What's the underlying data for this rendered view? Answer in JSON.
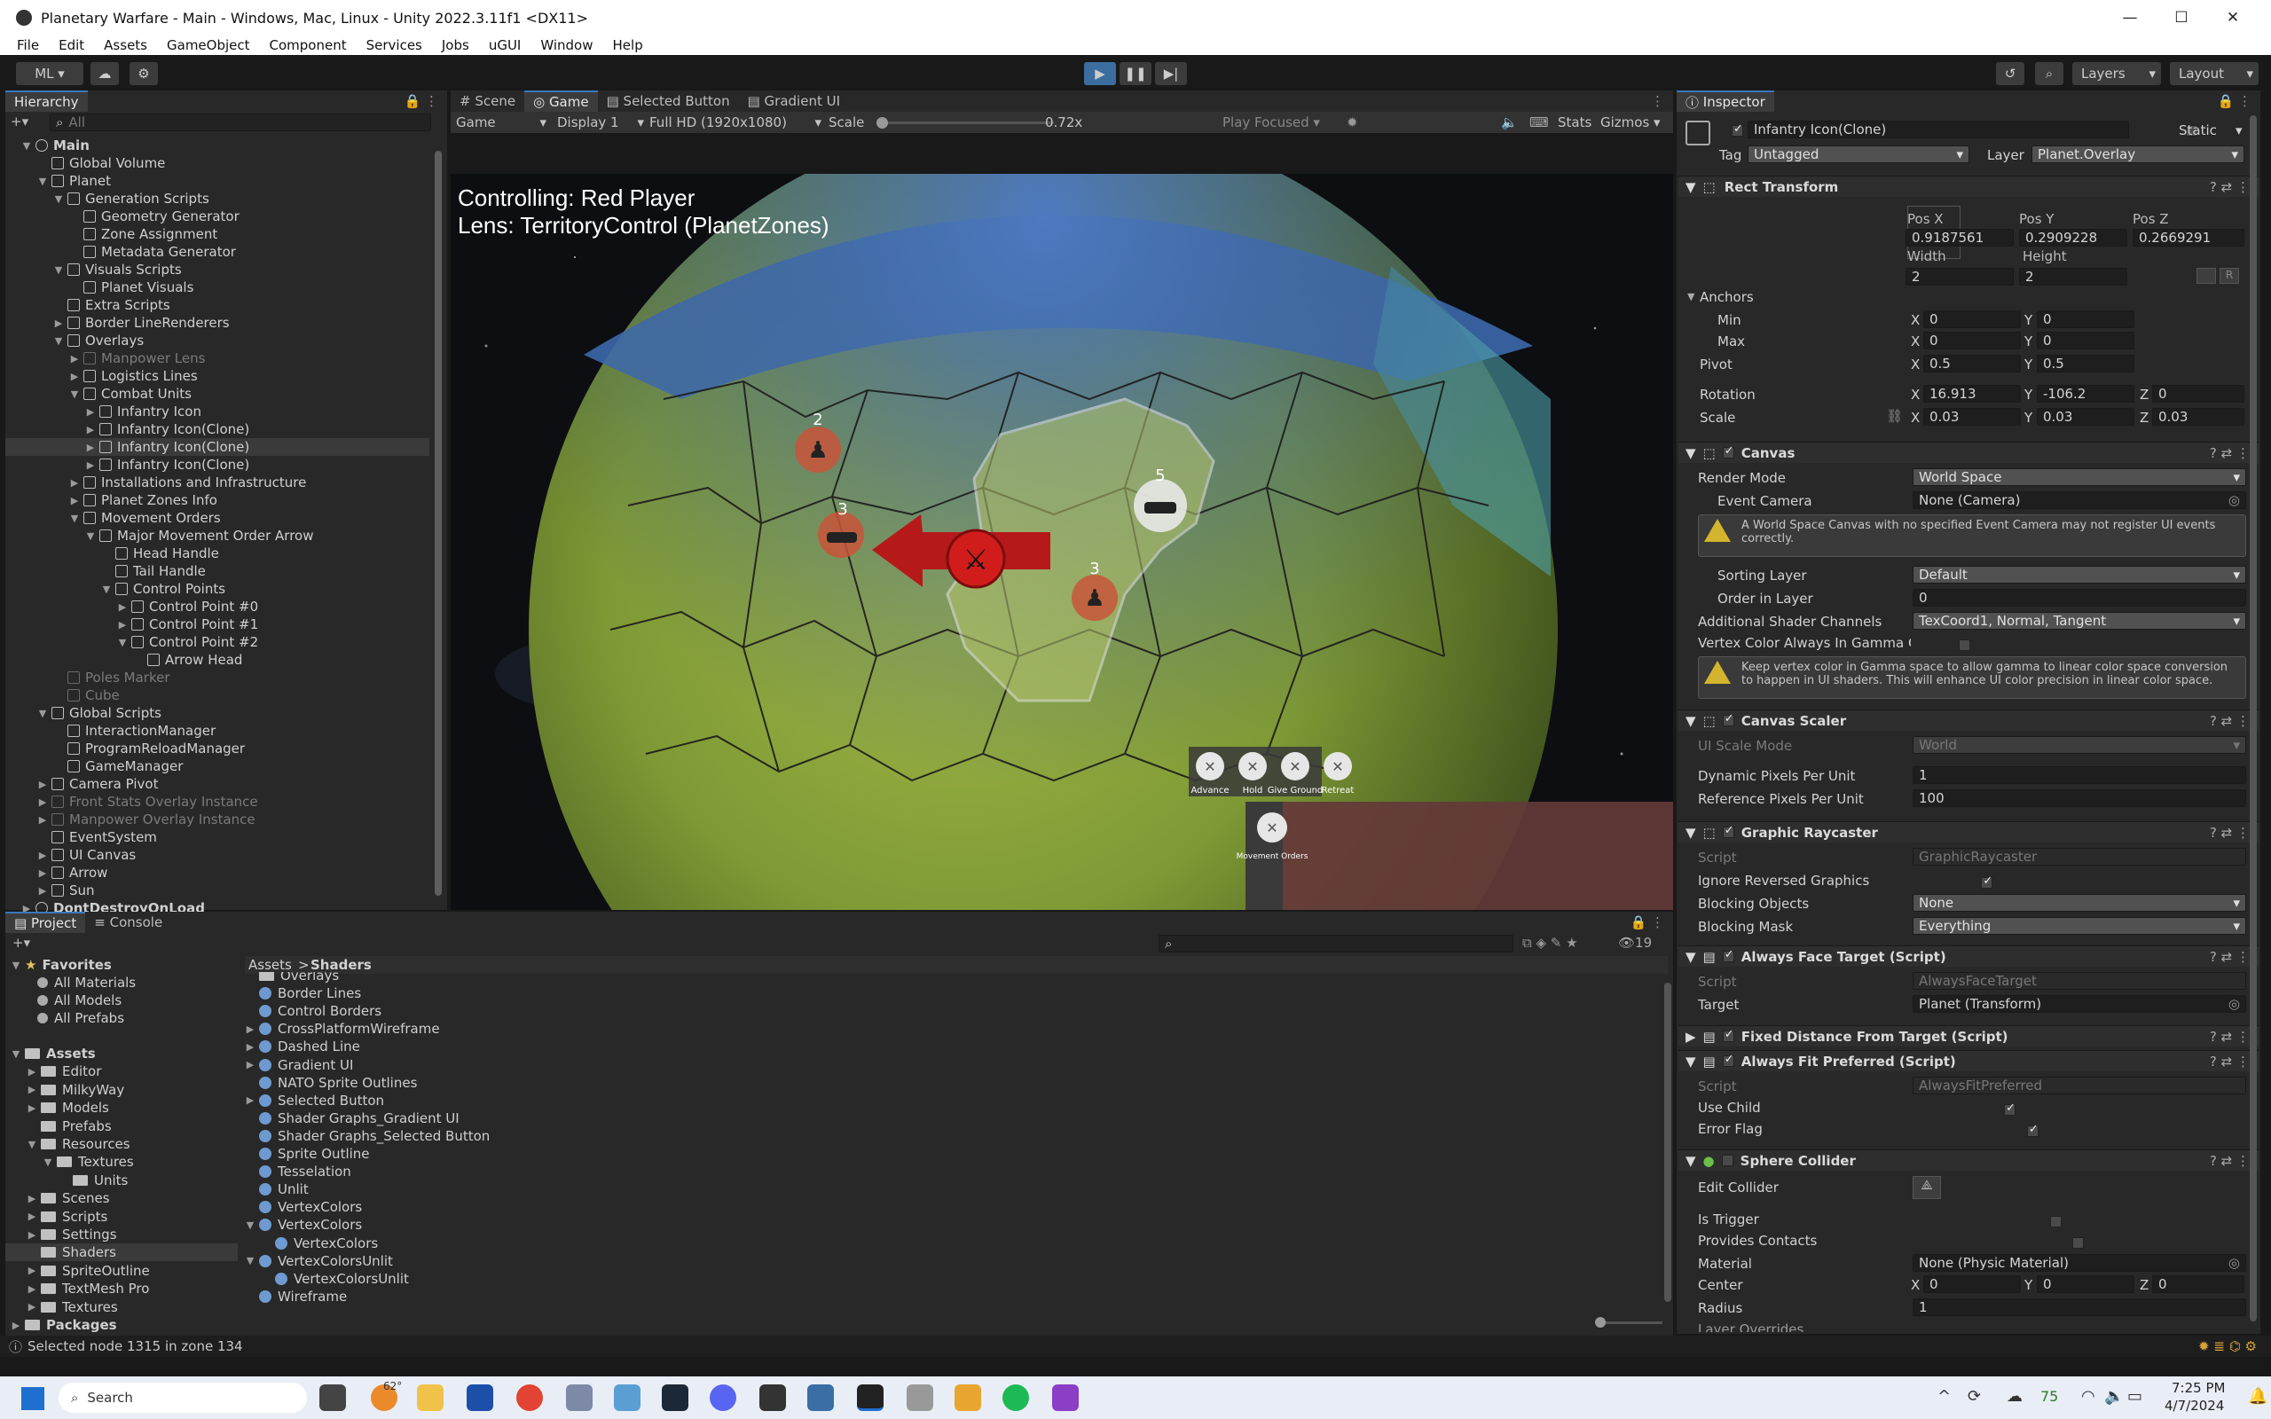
{
  "window": {
    "title": "Planetary Warfare - Main - Windows, Mac, Linux - Unity 2022.3.11f1 <DX11>",
    "minimize": "—",
    "maximize": "☐",
    "close": "✕"
  },
  "menu": [
    "File",
    "Edit",
    "Assets",
    "GameObject",
    "Component",
    "Services",
    "Jobs",
    "uGUI",
    "Window",
    "Help"
  ],
  "toolbar": {
    "account": "ML ▾",
    "layers": "Layers",
    "layout": "Layout"
  },
  "hierarchy": {
    "tab": "Hierarchy",
    "search_placeholder": "All",
    "rows": [
      {
        "label": "Main",
        "indent": 0,
        "arrow": "▼",
        "style": "scene"
      },
      {
        "label": "Global Volume",
        "indent": 1,
        "arrow": "",
        "style": ""
      },
      {
        "label": "Planet",
        "indent": 1,
        "arrow": "▼",
        "style": ""
      },
      {
        "label": "Generation Scripts",
        "indent": 2,
        "arrow": "▼",
        "style": ""
      },
      {
        "label": "Geometry Generator",
        "indent": 3,
        "arrow": "",
        "style": ""
      },
      {
        "label": "Zone Assignment",
        "indent": 3,
        "arrow": "",
        "style": ""
      },
      {
        "label": "Metadata Generator",
        "indent": 3,
        "arrow": "",
        "style": ""
      },
      {
        "label": "Visuals Scripts",
        "indent": 2,
        "arrow": "▼",
        "style": ""
      },
      {
        "label": "Planet Visuals",
        "indent": 3,
        "arrow": "",
        "style": ""
      },
      {
        "label": "Extra Scripts",
        "indent": 2,
        "arrow": "",
        "style": ""
      },
      {
        "label": "Border LineRenderers",
        "indent": 2,
        "arrow": "▶",
        "style": ""
      },
      {
        "label": "Overlays",
        "indent": 2,
        "arrow": "▼",
        "style": ""
      },
      {
        "label": "Manpower Lens",
        "indent": 3,
        "arrow": "▶",
        "style": "dim"
      },
      {
        "label": "Logistics Lines",
        "indent": 3,
        "arrow": "▶",
        "style": ""
      },
      {
        "label": "Combat Units",
        "indent": 3,
        "arrow": "▼",
        "style": ""
      },
      {
        "label": "Infantry Icon",
        "indent": 4,
        "arrow": "▶",
        "style": ""
      },
      {
        "label": "Infantry Icon(Clone)",
        "indent": 4,
        "arrow": "▶",
        "style": ""
      },
      {
        "label": "Infantry Icon(Clone)",
        "indent": 4,
        "arrow": "▶",
        "style": "hl"
      },
      {
        "label": "Infantry Icon(Clone)",
        "indent": 4,
        "arrow": "▶",
        "style": ""
      },
      {
        "label": "Installations and Infrastructure",
        "indent": 3,
        "arrow": "▶",
        "style": ""
      },
      {
        "label": "Planet Zones Info",
        "indent": 3,
        "arrow": "▶",
        "style": ""
      },
      {
        "label": "Movement Orders",
        "indent": 3,
        "arrow": "▼",
        "style": ""
      },
      {
        "label": "Major Movement Order Arrow",
        "indent": 4,
        "arrow": "▼",
        "style": ""
      },
      {
        "label": "Head Handle",
        "indent": 5,
        "arrow": "",
        "style": ""
      },
      {
        "label": "Tail Handle",
        "indent": 5,
        "arrow": "",
        "style": ""
      },
      {
        "label": "Control Points",
        "indent": 5,
        "arrow": "▼",
        "style": ""
      },
      {
        "label": "Control Point #0",
        "indent": 6,
        "arrow": "▶",
        "style": ""
      },
      {
        "label": "Control Point #1",
        "indent": 6,
        "arrow": "▶",
        "style": ""
      },
      {
        "label": "Control Point #2",
        "indent": 6,
        "arrow": "▼",
        "style": ""
      },
      {
        "label": "Arrow Head",
        "indent": 7,
        "arrow": "",
        "style": ""
      },
      {
        "label": "Poles Marker",
        "indent": 2,
        "arrow": "",
        "style": "dim"
      },
      {
        "label": "Cube",
        "indent": 2,
        "arrow": "",
        "style": "dim"
      },
      {
        "label": "Global Scripts",
        "indent": 1,
        "arrow": "▼",
        "style": ""
      },
      {
        "label": "InteractionManager",
        "indent": 2,
        "arrow": "",
        "style": ""
      },
      {
        "label": "ProgramReloadManager",
        "indent": 2,
        "arrow": "",
        "style": ""
      },
      {
        "label": "GameManager",
        "indent": 2,
        "arrow": "",
        "style": ""
      },
      {
        "label": "Camera Pivot",
        "indent": 1,
        "arrow": "▶",
        "style": ""
      },
      {
        "label": "Front Stats Overlay Instance",
        "indent": 1,
        "arrow": "▶",
        "style": "dim"
      },
      {
        "label": "Manpower Overlay Instance",
        "indent": 1,
        "arrow": "▶",
        "style": "dim"
      },
      {
        "label": "EventSystem",
        "indent": 1,
        "arrow": "",
        "style": ""
      },
      {
        "label": "UI Canvas",
        "indent": 1,
        "arrow": "▶",
        "style": ""
      },
      {
        "label": "Arrow",
        "indent": 1,
        "arrow": "▶",
        "style": ""
      },
      {
        "label": "Sun",
        "indent": 1,
        "arrow": "▶",
        "style": ""
      },
      {
        "label": "DontDestroyOnLoad",
        "indent": 0,
        "arrow": "▶",
        "style": "scene"
      }
    ]
  },
  "scene_tabs": [
    {
      "label": "Scene"
    },
    {
      "label": "Game"
    },
    {
      "label": "Selected Button"
    },
    {
      "label": "Gradient UI"
    }
  ],
  "game_bar": {
    "mode": "Game",
    "display": "Display 1",
    "resolution": "Full HD (1920x1080)",
    "scale_label": "Scale",
    "scale_value": "0.72x",
    "play_focused": "Play Focused",
    "stats": "Stats",
    "gizmos": "Gizmos"
  },
  "game_view": {
    "controlling": "Controlling: Red Player",
    "lens": "Lens: TerritoryControl (PlanetZones)",
    "unit_counts": [
      "2",
      "3",
      "5",
      "3"
    ],
    "orders": [
      {
        "label": "Advance"
      },
      {
        "label": "Hold"
      },
      {
        "label": "Give Ground"
      },
      {
        "label": "Retreat"
      }
    ],
    "movement_orders": "Movement Orders"
  },
  "inspector": {
    "tab": "Inspector",
    "object_name": "Infantry Icon(Clone)",
    "static_label": "Static",
    "tag_label": "Tag",
    "tag_value": "Untagged",
    "layer_label": "Layer",
    "layer_value": "Planet.Overlay",
    "rect_transform": {
      "title": "Rect Transform",
      "posx_label": "Pos X",
      "posy_label": "Pos Y",
      "posz_label": "Pos Z",
      "posx": "0.9187561",
      "posy": "0.2909228",
      "posz": "0.2669291",
      "width_label": "Width",
      "height_label": "Height",
      "width": "2",
      "height": "2",
      "anchors": "Anchors",
      "min": "Min",
      "max": "Max",
      "min_x": "0",
      "min_y": "0",
      "max_x": "0",
      "max_y": "0",
      "pivot": "Pivot",
      "pivot_x": "0.5",
      "pivot_y": "0.5",
      "rotation": "Rotation",
      "rot_x": "16.913",
      "rot_y": "-106.2",
      "rot_z": "0",
      "scale": "Scale",
      "scale_x": "0.03",
      "scale_y": "0.03",
      "scale_z": "0.03",
      "raw_btn": "R"
    },
    "canvas": {
      "title": "Canvas",
      "render_mode_label": "Render Mode",
      "render_mode": "World Space",
      "event_camera_label": "Event Camera",
      "event_camera": "None (Camera)",
      "warning1": "A World Space Canvas with no specified Event Camera may not register UI events correctly.",
      "sorting_layer_label": "Sorting Layer",
      "sorting_layer": "Default",
      "order_label": "Order in Layer",
      "order": "0",
      "shader_channels_label": "Additional Shader Channels",
      "shader_channels": "TexCoord1, Normal, Tangent",
      "vertex_color_label": "Vertex Color Always In Gamma C",
      "warning2": "Keep vertex color in Gamma space to allow gamma to linear color space conversion to happen in UI shaders. This will enhance UI color precision in linear color space."
    },
    "canvas_scaler": {
      "title": "Canvas Scaler",
      "ui_scale_label": "UI Scale Mode",
      "ui_scale": "World",
      "dynamic_label": "Dynamic Pixels Per Unit",
      "dynamic": "1",
      "reference_label": "Reference Pixels Per Unit",
      "reference": "100"
    },
    "graphic_raycaster": {
      "title": "Graphic Raycaster",
      "script_label": "Script",
      "script": "GraphicRaycaster",
      "ignore_label": "Ignore Reversed Graphics",
      "blocking_objects_label": "Blocking Objects",
      "blocking_objects": "None",
      "blocking_mask_label": "Blocking Mask",
      "blocking_mask": "Everything"
    },
    "always_face": {
      "title": "Always Face Target (Script)",
      "script_label": "Script",
      "script": "AlwaysFaceTarget",
      "target_label": "Target",
      "target": "Planet (Transform)"
    },
    "fixed_distance": {
      "title": "Fixed Distance From Target (Script)"
    },
    "always_fit": {
      "title": "Always Fit Preferred (Script)",
      "script_label": "Script",
      "script": "AlwaysFitPreferred",
      "use_child_label": "Use Child",
      "error_flag_label": "Error Flag"
    },
    "sphere_collider": {
      "title": "Sphere Collider",
      "edit_label": "Edit Collider",
      "trigger_label": "Is Trigger",
      "contacts_label": "Provides Contacts",
      "material_label": "Material",
      "material": "None (Physic Material)",
      "center_label": "Center",
      "center_x": "0",
      "center_y": "0",
      "center_z": "0",
      "radius_label": "Radius",
      "radius": "1",
      "layer_overrides": "Layer Overrides"
    }
  },
  "project": {
    "tabs": [
      {
        "label": "Project"
      },
      {
        "label": "Console"
      }
    ],
    "breadcrumb": [
      "Assets",
      "Shaders"
    ],
    "hidden_count": "19",
    "favorites": "Favorites",
    "fav_items": [
      "All Materials",
      "All Models",
      "All Prefabs"
    ],
    "tree": [
      {
        "label": "Assets",
        "indent": 0,
        "arrow": "▼"
      },
      {
        "label": "Editor",
        "indent": 1,
        "arrow": "▶"
      },
      {
        "label": "MilkyWay",
        "indent": 1,
        "arrow": "▶"
      },
      {
        "label": "Models",
        "indent": 1,
        "arrow": "▶"
      },
      {
        "label": "Prefabs",
        "indent": 1,
        "arrow": ""
      },
      {
        "label": "Resources",
        "indent": 1,
        "arrow": "▼"
      },
      {
        "label": "Textures",
        "indent": 2,
        "arrow": "▼"
      },
      {
        "label": "Units",
        "indent": 3,
        "arrow": ""
      },
      {
        "label": "Scenes",
        "indent": 1,
        "arrow": "▶"
      },
      {
        "label": "Scripts",
        "indent": 1,
        "arrow": "▶"
      },
      {
        "label": "Settings",
        "indent": 1,
        "arrow": "▶"
      },
      {
        "label": "Shaders",
        "indent": 1,
        "arrow": ""
      },
      {
        "label": "SpriteOutline",
        "indent": 1,
        "arrow": "▶"
      },
      {
        "label": "TextMesh Pro",
        "indent": 1,
        "arrow": "▶"
      },
      {
        "label": "Textures",
        "indent": 1,
        "arrow": "▶"
      },
      {
        "label": "Packages",
        "indent": 0,
        "arrow": "▶"
      }
    ],
    "files": [
      {
        "label": "Overlays",
        "indent": 0,
        "arrow": "",
        "kind": "folder"
      },
      {
        "label": "Border Lines",
        "indent": 0,
        "arrow": "",
        "kind": "shader"
      },
      {
        "label": "Control Borders",
        "indent": 0,
        "arrow": "",
        "kind": "shader"
      },
      {
        "label": "CrossPlatformWireframe",
        "indent": 0,
        "arrow": "▶",
        "kind": "shader"
      },
      {
        "label": "Dashed Line",
        "indent": 0,
        "arrow": "▶",
        "kind": "shader"
      },
      {
        "label": "Gradient UI",
        "indent": 0,
        "arrow": "▶",
        "kind": "shader"
      },
      {
        "label": "NATO Sprite Outlines",
        "indent": 0,
        "arrow": "",
        "kind": "shader"
      },
      {
        "label": "Selected Button",
        "indent": 0,
        "arrow": "▶",
        "kind": "shader"
      },
      {
        "label": "Shader Graphs_Gradient UI",
        "indent": 0,
        "arrow": "",
        "kind": "shader"
      },
      {
        "label": "Shader Graphs_Selected Button",
        "indent": 0,
        "arrow": "",
        "kind": "shader"
      },
      {
        "label": "Sprite Outline",
        "indent": 0,
        "arrow": "",
        "kind": "shader"
      },
      {
        "label": "Tesselation",
        "indent": 0,
        "arrow": "",
        "kind": "shader"
      },
      {
        "label": "Unlit",
        "indent": 0,
        "arrow": "",
        "kind": "shader"
      },
      {
        "label": "VertexColors",
        "indent": 0,
        "arrow": "",
        "kind": "shader"
      },
      {
        "label": "VertexColors",
        "indent": 0,
        "arrow": "▼",
        "kind": "shader"
      },
      {
        "label": "VertexColors",
        "indent": 1,
        "arrow": "",
        "kind": "shader"
      },
      {
        "label": "VertexColorsUnlit",
        "indent": 0,
        "arrow": "▼",
        "kind": "shader"
      },
      {
        "label": "VertexColorsUnlit",
        "indent": 1,
        "arrow": "",
        "kind": "shader"
      },
      {
        "label": "Wireframe",
        "indent": 0,
        "arrow": "",
        "kind": "shader"
      }
    ]
  },
  "status": {
    "message": "Selected node 1315 in zone 134"
  },
  "taskbar": {
    "search": "Search",
    "weather": "62°",
    "battery": "75",
    "time": "7:25 PM",
    "date": "4/7/2024"
  }
}
